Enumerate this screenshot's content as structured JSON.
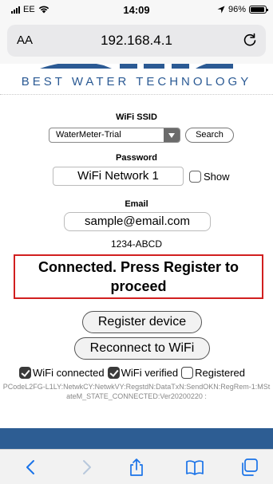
{
  "status_bar": {
    "carrier": "EE",
    "time": "14:09",
    "battery": "96%",
    "battery_level": 0.96
  },
  "browser": {
    "reader_button": "AA",
    "url": "192.168.4.1"
  },
  "logo": {
    "tagline": "BEST WATER TECHNOLOGY",
    "brand_color": "#2b5a94"
  },
  "form": {
    "ssid_label": "WiFi SSID",
    "ssid_selected": "WaterMeter-Trial",
    "search_button": "Search",
    "password_label": "Password",
    "password_value": "WiFi Network 1",
    "show_label": "Show",
    "email_label": "Email",
    "email_value": "sample@email.com",
    "device_code": "1234-ABCD"
  },
  "status": {
    "message": "Connected. Press Register to proceed",
    "border_color": "#d11f1f"
  },
  "actions": {
    "register_button": "Register device",
    "reconnect_button": "Reconnect to WiFi"
  },
  "checks": {
    "wifi_connected": "WiFi connected",
    "wifi_verified": "WiFi verified",
    "registered": "Registered"
  },
  "debug": {
    "text": "PCodeL2FG-L1LY:NetwkCY:NetwkVY:RegstdN:DataTxN:SendOKN:RegRem-1:MStateM_STATE_CONNECTED:Ver20200220 :"
  },
  "toolbar": {
    "icons": [
      "back-icon",
      "forward-icon",
      "share-icon",
      "bookmarks-icon",
      "tabs-icon"
    ]
  }
}
